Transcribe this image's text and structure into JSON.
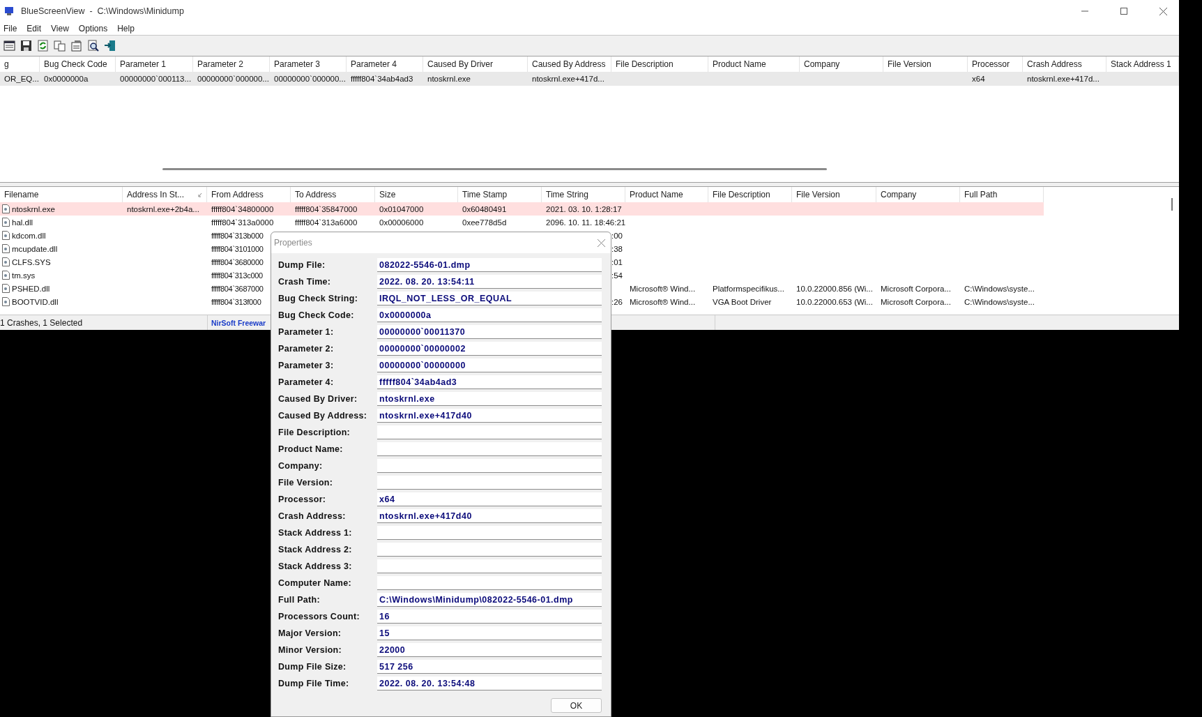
{
  "window": {
    "title": "BlueScreenView  -  C:\\Windows\\Minidump"
  },
  "menu": [
    "File",
    "Edit",
    "View",
    "Options",
    "Help"
  ],
  "crash_table": {
    "columns": [
      "g",
      "Bug Check Code",
      "Parameter 1",
      "Parameter 2",
      "Parameter 3",
      "Parameter 4",
      "Caused By Driver",
      "Caused By Address",
      "File Description",
      "Product Name",
      "Company",
      "File Version",
      "Processor",
      "Crash Address",
      "Stack Address 1"
    ],
    "rows": [
      {
        "selected": true,
        "cells": [
          "OR_EQ...",
          "0x0000000a",
          "00000000`000113...",
          "00000000`000000...",
          "00000000`000000...",
          "fffff804`34ab4ad3",
          "ntoskrnl.exe",
          "ntoskrnl.exe+417d...",
          null,
          null,
          null,
          null,
          "x64",
          "ntoskrnl.exe+417d...",
          null
        ]
      }
    ]
  },
  "module_table": {
    "columns": [
      {
        "label": "Filename",
        "sorted": false
      },
      {
        "label": "Address In St...",
        "sorted": true
      },
      {
        "label": "From Address",
        "sorted": false
      },
      {
        "label": "To Address",
        "sorted": false
      },
      {
        "label": "Size",
        "sorted": false
      },
      {
        "label": "Time Stamp",
        "sorted": false
      },
      {
        "label": "Time String",
        "sorted": false
      },
      {
        "label": "Product Name",
        "sorted": false
      },
      {
        "label": "File Description",
        "sorted": false
      },
      {
        "label": "File Version",
        "sorted": false
      },
      {
        "label": "Company",
        "sorted": false
      },
      {
        "label": "Full Path",
        "sorted": false
      }
    ],
    "rows": [
      {
        "selected": true,
        "cells": [
          "ntoskrnl.exe",
          "ntoskrnl.exe+2b4a...",
          "fffff804`34800000",
          "fffff804`35847000",
          "0x01047000",
          "0x60480491",
          "2021. 03. 10. 1:28:17",
          null,
          null,
          null,
          null,
          null
        ]
      },
      {
        "selected": false,
        "cells": [
          "hal.dll",
          null,
          "fffff804`313a0000",
          "fffff804`313a6000",
          "0x00006000",
          "0xee778d5d",
          "2096. 10. 11. 18:46:21",
          null,
          null,
          null,
          null,
          null
        ]
      },
      {
        "selected": false,
        "cells": [
          "kdcom.dll",
          null,
          "fffff804`313b000",
          null,
          null,
          null,
          ":00",
          null,
          null,
          null,
          null,
          null
        ]
      },
      {
        "selected": false,
        "cells": [
          "mcupdate.dll",
          null,
          "fffff804`3101000",
          null,
          null,
          null,
          ":38",
          null,
          null,
          null,
          null,
          null
        ]
      },
      {
        "selected": false,
        "cells": [
          "CLFS.SYS",
          null,
          "fffff804`3680000",
          null,
          null,
          null,
          ":01",
          null,
          null,
          null,
          null,
          null
        ]
      },
      {
        "selected": false,
        "cells": [
          "tm.sys",
          null,
          "fffff804`313c000",
          null,
          null,
          null,
          ":54",
          null,
          null,
          null,
          null,
          null
        ]
      },
      {
        "selected": false,
        "cells": [
          "PSHED.dll",
          null,
          "fffff804`3687000",
          null,
          null,
          null,
          null,
          "Microsoft® Wind...",
          "Platformspecifikus...",
          "10.0.22000.856 (Wi...",
          "Microsoft Corpora...",
          "C:\\Windows\\syste..."
        ]
      },
      {
        "selected": false,
        "cells": [
          "BOOTVID.dll",
          null,
          "fffff804`313f000",
          null,
          null,
          null,
          ":26",
          "Microsoft® Wind...",
          "VGA Boot Driver",
          "10.0.22000.653 (Wi...",
          "Microsoft Corpora...",
          "C:\\Windows\\syste..."
        ]
      }
    ]
  },
  "status_bar": [
    "1 Crashes, 1 Selected",
    "NirSoft Freewar"
  ],
  "dialog": {
    "title": "Properties",
    "fields": [
      {
        "label": "Dump File:",
        "value": "082022-5546-01.dmp"
      },
      {
        "label": "Crash Time:",
        "value": "2022. 08. 20. 13:54:11"
      },
      {
        "label": "Bug Check String:",
        "value": "IRQL_NOT_LESS_OR_EQUAL"
      },
      {
        "label": "Bug Check Code:",
        "value": "0x0000000a"
      },
      {
        "label": "Parameter 1:",
        "value": "00000000`00011370"
      },
      {
        "label": "Parameter 2:",
        "value": "00000000`00000002"
      },
      {
        "label": "Parameter 3:",
        "value": "00000000`00000000"
      },
      {
        "label": "Parameter 4:",
        "value": "fffff804`34ab4ad3"
      },
      {
        "label": "Caused By Driver:",
        "value": "ntoskrnl.exe"
      },
      {
        "label": "Caused By Address:",
        "value": "ntoskrnl.exe+417d40"
      },
      {
        "label": "File Description:"
      },
      {
        "label": "Product Name:"
      },
      {
        "label": "Company:"
      },
      {
        "label": "File Version:"
      },
      {
        "label": "Processor:",
        "value": "x64"
      },
      {
        "label": "Crash Address:",
        "value": "ntoskrnl.exe+417d40"
      },
      {
        "label": "Stack Address 1:"
      },
      {
        "label": "Stack Address 2:"
      },
      {
        "label": "Stack Address 3:"
      },
      {
        "label": "Computer Name:"
      },
      {
        "label": "Full Path:",
        "value": "C:\\Windows\\Minidump\\082022-5546-01.dmp"
      },
      {
        "label": "Processors Count:",
        "value": "16"
      },
      {
        "label": "Major Version:",
        "value": "15"
      },
      {
        "label": "Minor Version:",
        "value": "22000"
      },
      {
        "label": "Dump File Size:",
        "value": "517 256"
      },
      {
        "label": "Dump File Time:",
        "value": "2022. 08. 20. 13:54:48"
      }
    ],
    "ok_button": "OK"
  }
}
